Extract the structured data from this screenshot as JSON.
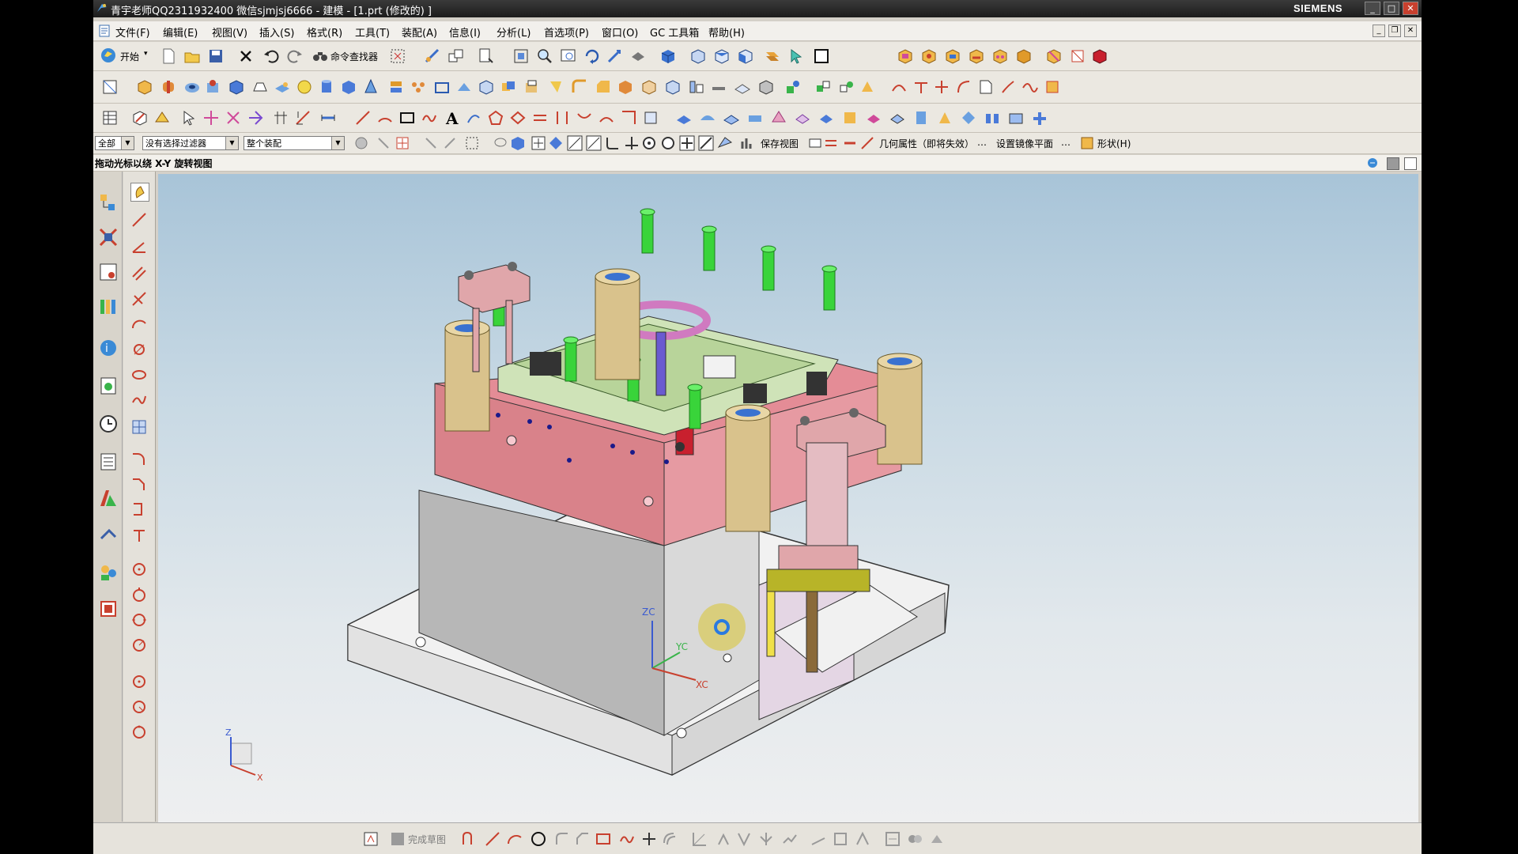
{
  "window": {
    "title": "青宇老师QQ2311932400 微信sjmjsj6666 - 建模 - [1.prt  (修改的) ]",
    "brand": "SIEMENS",
    "controls": [
      "_",
      "□",
      "✕"
    ]
  },
  "menubar": {
    "items": [
      "文件(F)",
      "编辑(E)",
      "视图(V)",
      "插入(S)",
      "格式(R)",
      "工具(T)",
      "装配(A)",
      "信息(I)",
      "分析(L)",
      "首选项(P)",
      "窗口(O)",
      "GC 工具箱",
      "帮助(H)"
    ]
  },
  "toolbar1": {
    "start_label": "开始",
    "command_finder_label": "命令查找器"
  },
  "selection_bar": {
    "filter_all": "全部",
    "type_filter": "没有选择过滤器",
    "scope": "整个装配",
    "save_view_label": "保存视图",
    "geometry_attr_label": "几何属性（即将失效）",
    "mirror_plane_label": "设置镜像平面",
    "shape_label": "形状(H)"
  },
  "cue_line": {
    "text": "拖动光标以绕  X-Y  旋转视图"
  },
  "bottom_toolbar": {
    "finish_sketch_label": "完成草图"
  },
  "viewport": {
    "csys_labels": {
      "z": "ZC",
      "y": "YC",
      "x": "XC"
    },
    "view_triad": {
      "z": "Z",
      "x": "X"
    }
  },
  "colors": {
    "titlebar": "#1c1c1c",
    "plate_pink": "#d9828a",
    "plate_gray": "#b7b7b7",
    "base_white": "#f1f1f1",
    "guide_bushing": "#d9c28c",
    "screw_green": "#39d43a",
    "viewport_top": "#a8c4d8"
  }
}
